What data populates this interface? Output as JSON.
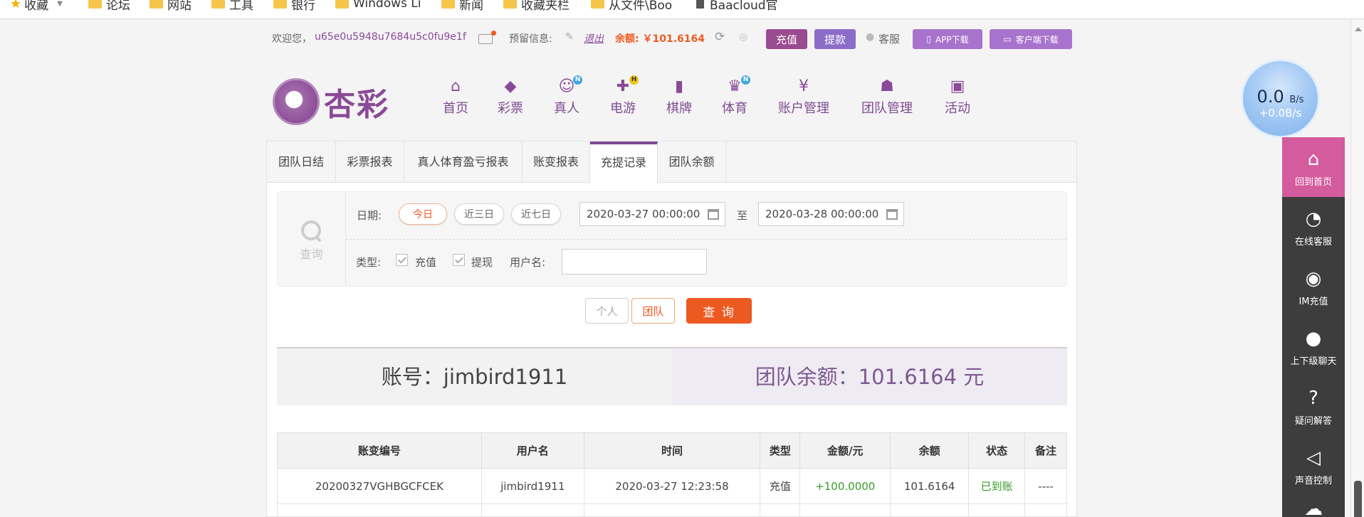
{
  "bookmarks": [
    {
      "label": "收藏",
      "icon": "star-icon"
    },
    {
      "label": "论坛",
      "icon": "folder-icon"
    },
    {
      "label": "网站",
      "icon": "folder-icon"
    },
    {
      "label": "工具",
      "icon": "folder-icon"
    },
    {
      "label": "银行",
      "icon": "folder-icon"
    },
    {
      "label": "Windows Li",
      "icon": "folder-icon"
    },
    {
      "label": "新闻",
      "icon": "folder-icon"
    },
    {
      "label": "收藏夹栏",
      "icon": "folder-icon"
    },
    {
      "label": "从文件\\Boo",
      "icon": "folder-icon"
    },
    {
      "label": "Baacloud官",
      "icon": "page-icon"
    }
  ],
  "userbar": {
    "welcome": "欢迎您，",
    "username": "u65e0u5948u7684u5c0fu9e1f",
    "reserve_label": "预留信息:",
    "logout": "退出",
    "balance_label": "余额: ￥101.6164",
    "recharge": "充值",
    "withdraw": "提款",
    "service": "客服",
    "app_download": "APP下载",
    "client_download": "客户端下载"
  },
  "logo_text": "杏彩",
  "nav": [
    {
      "label": "首页",
      "icon": "home-icon",
      "badge": ""
    },
    {
      "label": "彩票",
      "icon": "lottery-icon",
      "badge": ""
    },
    {
      "label": "真人",
      "icon": "live-dealer-icon",
      "badge": "N"
    },
    {
      "label": "电游",
      "icon": "gamepad-icon",
      "badge": "H"
    },
    {
      "label": "棋牌",
      "icon": "cards-icon",
      "badge": ""
    },
    {
      "label": "体育",
      "icon": "trophy-icon",
      "badge": "N"
    },
    {
      "label": "账户管理",
      "icon": "coin-icon",
      "badge": ""
    },
    {
      "label": "团队管理",
      "icon": "team-icon",
      "badge": ""
    },
    {
      "label": "活动",
      "icon": "gift-icon",
      "badge": ""
    }
  ],
  "tabs": [
    "团队日结",
    "彩票报表",
    "真人体育盈亏报表",
    "账变报表",
    "充提记录",
    "团队余额"
  ],
  "active_tab": "充提记录",
  "search": {
    "panel_label": "查询",
    "date_label": "日期:",
    "quick_ranges": [
      "今日",
      "近三日",
      "近七日"
    ],
    "date_from": "2020-03-27 00:00:00",
    "date_to_sep": "至",
    "date_to": "2020-03-28 00:00:00",
    "type_label": "类型:",
    "type_options": [
      "充值",
      "提现"
    ],
    "username_label": "用户名:",
    "username_value": ""
  },
  "actions": {
    "personal": "个人",
    "team": "团队",
    "query": "查 询"
  },
  "account": {
    "account_label": "账号：jimbird1911",
    "team_balance": "团队余额：101.6164 元"
  },
  "table": {
    "headers": [
      "账变编号",
      "用户名",
      "时间",
      "类型",
      "金额/元",
      "余额",
      "状态",
      "备注"
    ],
    "rows": [
      [
        "20200327VGHBGCFCEK",
        "jimbird1911",
        "2020-03-27 12:23:58",
        "充值",
        "+100.0000",
        "101.6164",
        "已到账",
        "----"
      ]
    ]
  },
  "speed": {
    "value": "0.0",
    "unit": "B/s",
    "sub": "+0.0B/s"
  },
  "sidebar": [
    {
      "label": "回到首页",
      "icon": "home-icon"
    },
    {
      "label": "在线客服",
      "icon": "headset-24-icon"
    },
    {
      "label": "IM充值",
      "icon": "im-recharge-icon"
    },
    {
      "label": "上下级聊天",
      "icon": "chat-icon"
    },
    {
      "label": "疑问解答",
      "icon": "question-icon"
    },
    {
      "label": "声音控制",
      "icon": "speaker-icon"
    }
  ],
  "colors": {
    "brand": "#8a4a97",
    "accent_orange": "#f05a22",
    "sidebar_active": "#d45b9d"
  }
}
